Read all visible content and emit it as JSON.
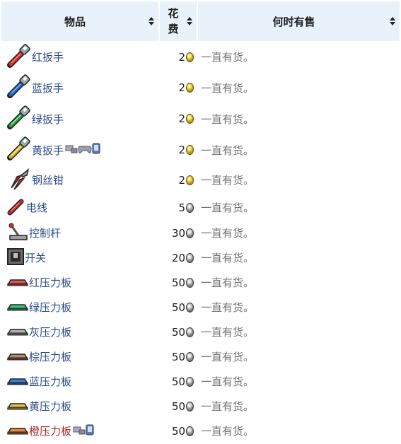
{
  "headers": {
    "item": "物品",
    "cost_line1": "花",
    "cost_line2": "费",
    "when": "何时有售"
  },
  "rows": [
    {
      "name": "红扳手",
      "cost": "2",
      "coin": "gold",
      "when": "一直有货。",
      "icon": "red-wrench-icon"
    },
    {
      "name": "蓝扳手",
      "cost": "2",
      "coin": "gold",
      "when": "一直有货。",
      "icon": "blue-wrench-icon"
    },
    {
      "name": "绿扳手",
      "cost": "2",
      "coin": "gold",
      "when": "一直有货。",
      "icon": "green-wrench-icon"
    },
    {
      "name": "黄扳手",
      "cost": "2",
      "coin": "gold",
      "when": "一直有货。",
      "icon": "yellow-wrench-icon"
    },
    {
      "name": "钢丝钳",
      "cost": "2",
      "coin": "gold",
      "when": "一直有货。",
      "icon": "wire-cutter-icon"
    },
    {
      "name": "电线",
      "cost": "5",
      "coin": "silver",
      "when": "一直有货。",
      "icon": "wire-icon"
    },
    {
      "name": "控制杆",
      "cost": "30",
      "coin": "silver",
      "when": "一直有货。",
      "icon": "lever-icon"
    },
    {
      "name": "开关",
      "cost": "20",
      "coin": "silver",
      "when": "一直有货。",
      "icon": "switch-icon"
    },
    {
      "name": "红压力板",
      "cost": "50",
      "coin": "silver",
      "when": "一直有货。",
      "icon": "red-pressure-plate-icon"
    },
    {
      "name": "绿压力板",
      "cost": "50",
      "coin": "silver",
      "when": "一直有货。",
      "icon": "green-pressure-plate-icon"
    },
    {
      "name": "灰压力板",
      "cost": "50",
      "coin": "silver",
      "when": "一直有货。",
      "icon": "gray-pressure-plate-icon"
    },
    {
      "name": "棕压力板",
      "cost": "50",
      "coin": "silver",
      "when": "一直有货。",
      "icon": "brown-pressure-plate-icon"
    },
    {
      "name": "蓝压力板",
      "cost": "50",
      "coin": "silver",
      "when": "一直有货。",
      "icon": "blue-pressure-plate-icon"
    },
    {
      "name": "黄压力板",
      "cost": "50",
      "coin": "silver",
      "when": "一直有货。",
      "icon": "yellow-pressure-plate-icon"
    },
    {
      "name": "橙压力板",
      "cost": "50",
      "coin": "silver",
      "when": "一直有货。",
      "icon": "orange-pressure-plate-icon"
    }
  ],
  "colors": {
    "header_bg": "#e9f2fb",
    "link": "#2a4b8d",
    "link_new": "#b22222",
    "muted": "#737373"
  }
}
